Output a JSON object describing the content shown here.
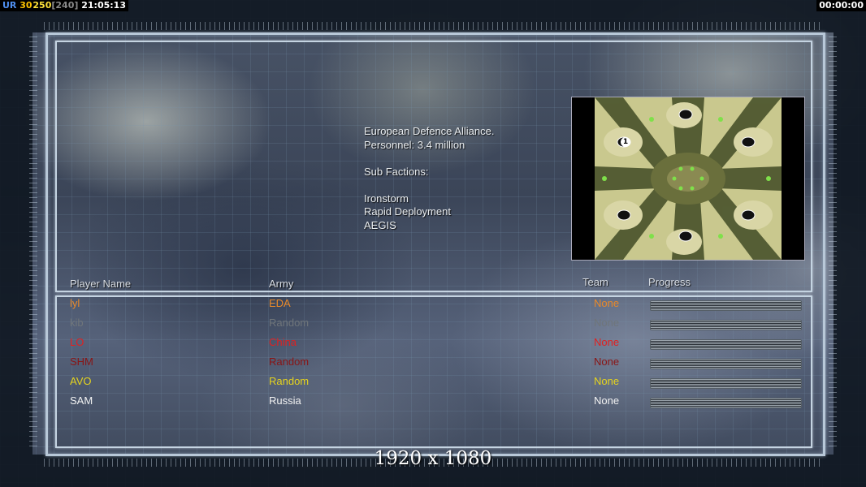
{
  "hud": {
    "label": "UR",
    "val1": "30",
    "val2": "250",
    "val3": "[240]",
    "clock": "21:05:13",
    "timer": "00:00:00"
  },
  "faction": {
    "lines": [
      "European Defence Alliance.",
      "Personnel: 3.4 million",
      "",
      "Sub Factions:",
      "",
      "Ironstorm",
      "Rapid Deployment",
      "AEGIS"
    ]
  },
  "minimap": {
    "player_marker": "1"
  },
  "table": {
    "headers": {
      "player": "Player Name",
      "army": "Army",
      "team": "Team",
      "progress": "Progress"
    },
    "rows": [
      {
        "name": "lyl",
        "army": "EDA",
        "team": "None",
        "color": "#e8892a",
        "progress": 1
      },
      {
        "name": "kib",
        "army": "Random",
        "team": "None",
        "color": "#6f757a",
        "progress": 1
      },
      {
        "name": "LO",
        "army": "China",
        "team": "None",
        "color": "#e02020",
        "progress": 1
      },
      {
        "name": "SHM",
        "army": "Random",
        "team": "None",
        "color": "#8a1414",
        "progress": 1
      },
      {
        "name": "AVO",
        "army": "Random",
        "team": "None",
        "color": "#e6d41e",
        "progress": 1
      },
      {
        "name": "SAM",
        "army": "Russia",
        "team": "None",
        "color": "#f2f2f2",
        "progress": 1
      }
    ]
  },
  "resolution": "1920 x 1080",
  "colors": {
    "hud_ur": "#4f8ff0",
    "hud_val1": "#ffc400",
    "hud_val2": "#ffe23a",
    "hud_val3": "#8a8a8a",
    "frame": "#c5d4e2"
  }
}
